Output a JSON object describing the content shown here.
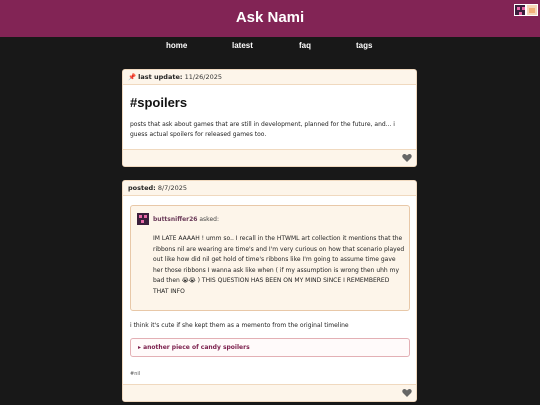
{
  "site": {
    "title": "Ask Nami"
  },
  "nav": [
    "home",
    "latest",
    "faq",
    "tags"
  ],
  "pinned_post": {
    "label": "last update",
    "date": "11/26/2025",
    "title": "#spoilers",
    "body": "posts that ask about games that are still in development, planned for the future, and... i guess actual spoilers for released games too."
  },
  "ask_post": {
    "label": "posted",
    "date": "8/7/2025",
    "asker": "buttsniffer26",
    "asker_suffix": "asked:",
    "question": "IM LATE AAAAH ! umm so.. I recall in the HTWML art collection it mentions that the ribbons nil are wearing are time's and I'm very curious on how that scenario played out like how did nil get hold of time's ribbons like I'm going to assume time gave her those ribbons I wanna ask like when ( if my assumption is wrong then uhh my bad then 😭😭 ) THIS QUESTION HAS BEEN ON MY MIND SINCE I REMEMBERED THAT INFO",
    "answer": "i think it's cute if she kept them as a memento from the original timeline",
    "spoiler_label": "another piece of candy spoilers",
    "tag": "#nil"
  },
  "colors": {
    "accent": "#822455",
    "background": "#181818",
    "card_border": "#f0d9bf"
  },
  "icons": {
    "pin": "pin-icon",
    "heart": "heart-icon",
    "spoiler_toggle": "triangle-right-icon"
  }
}
